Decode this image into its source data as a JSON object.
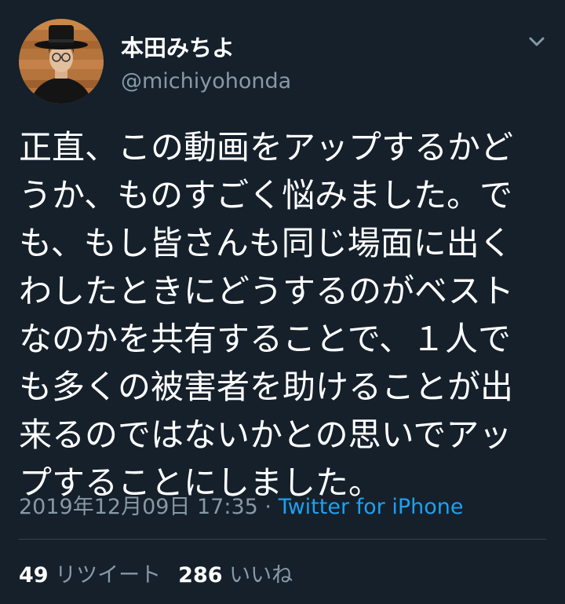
{
  "user": {
    "display_name": "本田みちよ",
    "handle": "@michiyohonda"
  },
  "icons": {
    "avatar": "avatar-photo",
    "more": "chevron-down-icon"
  },
  "tweet": {
    "lines": [
      "正直、この動画をアップするかど",
      "うか、ものすごく悩みました。で",
      "も、もし皆さんも同じ場面に出く",
      "わしたときにどうするのがベスト",
      "なのかを共有することで、１人で",
      "も多くの被害者を助けることが出",
      "来るのではないかとの思いでアッ",
      "プすることにしました。"
    ]
  },
  "meta": {
    "datetime": "2019年12月09日 17:35",
    "separator": " · ",
    "source": "Twitter for iPhone"
  },
  "stats": {
    "retweets_count": "49",
    "retweets_label": "リツイート",
    "likes_count": "286",
    "likes_label": "いいね"
  },
  "colors": {
    "background": "#15202b",
    "text": "#ffffff",
    "secondary": "#8899a6",
    "accent": "#1da1f2",
    "divider": "#38444d"
  }
}
